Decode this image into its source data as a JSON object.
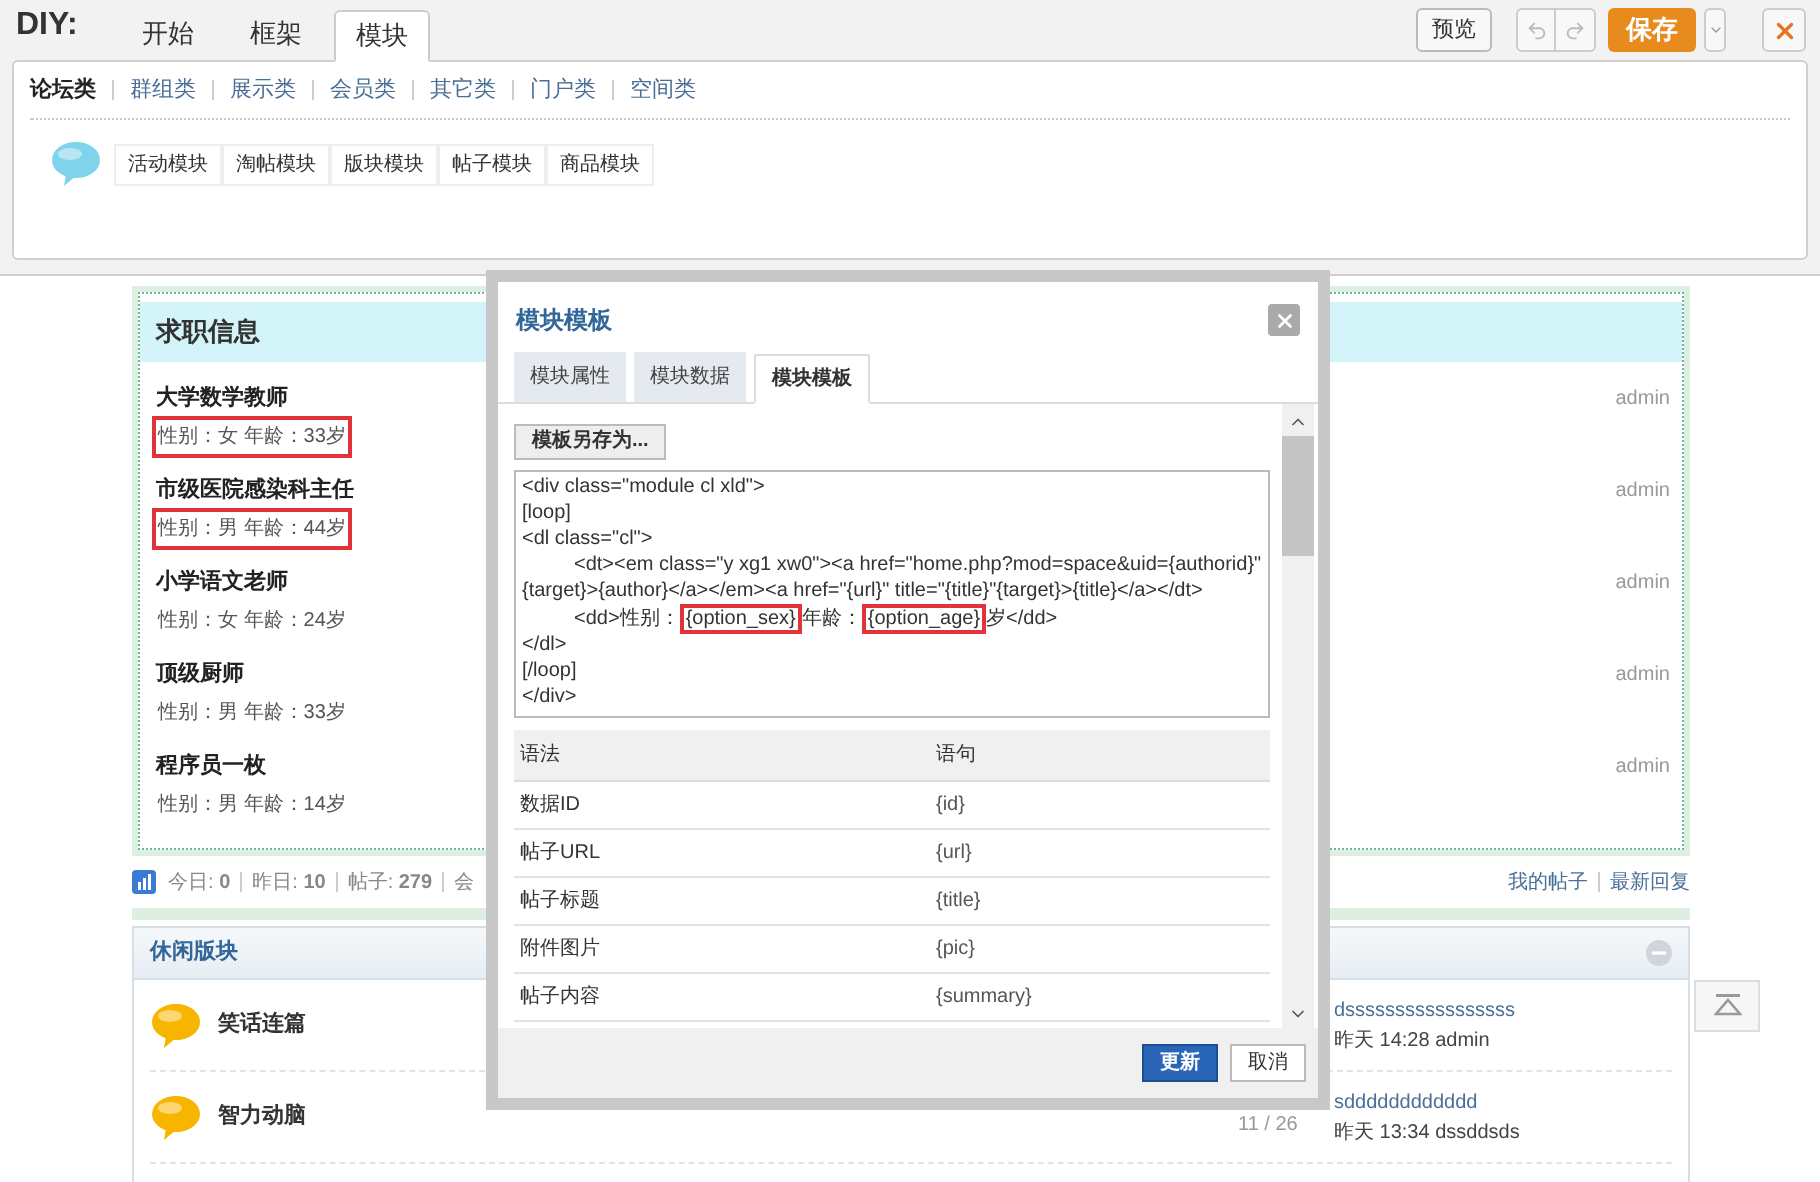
{
  "toolbar": {
    "brand": "DIY:",
    "tabs": [
      {
        "label": "开始",
        "selected": false
      },
      {
        "label": "框架",
        "selected": false
      },
      {
        "label": "模块",
        "selected": true
      }
    ],
    "preview": "预览",
    "save": "保存"
  },
  "categories": [
    {
      "label": "论坛类",
      "selected": true
    },
    {
      "label": "群组类",
      "selected": false
    },
    {
      "label": "展示类",
      "selected": false
    },
    {
      "label": "会员类",
      "selected": false
    },
    {
      "label": "其它类",
      "selected": false
    },
    {
      "label": "门户类",
      "selected": false
    },
    {
      "label": "空间类",
      "selected": false
    }
  ],
  "modules": [
    "活动模块",
    "淘帖模块",
    "版块模块",
    "帖子模块",
    "商品模块"
  ],
  "job_block": {
    "title": "求职信息",
    "items": [
      {
        "title": "大学数学教师",
        "detail": "性别：女 年龄：33岁",
        "highlighted": true,
        "author": "admin"
      },
      {
        "title": "市级医院感染科主任",
        "detail": "性别：男 年龄：44岁",
        "highlighted": true,
        "author": "admin"
      },
      {
        "title": "小学语文老师",
        "detail": "性别：女 年龄：24岁",
        "highlighted": false,
        "author": "admin"
      },
      {
        "title": "顶级厨师",
        "detail": "性别：男 年龄：33岁",
        "highlighted": false,
        "author": "admin"
      },
      {
        "title": "程序员一枚",
        "detail": "性别：男 年龄：14岁",
        "highlighted": false,
        "author": "admin"
      }
    ]
  },
  "stats": [
    "今日: **0**",
    "昨日: **10**",
    "帖子: **279**",
    "会"
  ],
  "links": [
    "我的帖子",
    "最新回复"
  ],
  "forum_block": {
    "title": "休闲版块",
    "page": "11 / 26",
    "rows": [
      {
        "name": "笑话连篇",
        "last_post": "dsssssssssssssssss",
        "last_info": "昨天 14:28 admin"
      },
      {
        "name": "智力动脑",
        "last_post": "sdddddddddddd",
        "last_info": "昨天 13:34 dssddsds"
      }
    ]
  },
  "dialog": {
    "title": "模块模板",
    "tabs": [
      {
        "label": "模块属性",
        "selected": false
      },
      {
        "label": "模块数据",
        "selected": false
      },
      {
        "label": "模块模板",
        "selected": true
      }
    ],
    "save_as": "模板另存为...",
    "code_lines": [
      {
        "indented": false,
        "parts": [
          {
            "text": "<div class=\"module cl xld\">",
            "boxed": false
          }
        ]
      },
      {
        "indented": false,
        "parts": [
          {
            "text": "[loop]",
            "boxed": false
          }
        ]
      },
      {
        "indented": false,
        "parts": [
          {
            "text": "<dl class=\"cl\">",
            "boxed": false
          }
        ]
      },
      {
        "indented": true,
        "parts": [
          {
            "text": "<dt><em class=\"y xg1 xw0\"><a href=\"home.php?mod=space&uid={authorid}\"",
            "boxed": false
          }
        ]
      },
      {
        "indented": false,
        "parts": [
          {
            "text": "{target}>{author}</a></em><a href=\"{url}\" title=\"{title}\"{target}>{title}</a></dt>",
            "boxed": false
          }
        ]
      },
      {
        "indented": true,
        "parts": [
          {
            "text": "<dd>性别：",
            "boxed": false
          },
          {
            "text": "{option_sex}",
            "boxed": true
          },
          {
            "text": "年龄：",
            "boxed": false
          },
          {
            "text": "{option_age}",
            "boxed": true
          },
          {
            "text": "岁</dd>",
            "boxed": false
          }
        ]
      },
      {
        "indented": false,
        "parts": [
          {
            "text": "</dl>",
            "boxed": false
          }
        ]
      },
      {
        "indented": false,
        "parts": [
          {
            "text": "[/loop]",
            "boxed": false
          }
        ]
      },
      {
        "indented": false,
        "parts": [
          {
            "text": "</div>",
            "boxed": false
          }
        ]
      }
    ],
    "table": {
      "columns": [
        "语法",
        "语句"
      ],
      "rows": [
        [
          "数据ID",
          "{id}"
        ],
        [
          "帖子URL",
          "{url}"
        ],
        [
          "帖子标题",
          "{title}"
        ],
        [
          "附件图片",
          "{pic}"
        ],
        [
          "帖子内容",
          "{summary}"
        ]
      ]
    },
    "buttons": [
      {
        "label": "更新",
        "kind": "primary"
      },
      {
        "label": "取消",
        "kind": "secondary"
      }
    ]
  }
}
